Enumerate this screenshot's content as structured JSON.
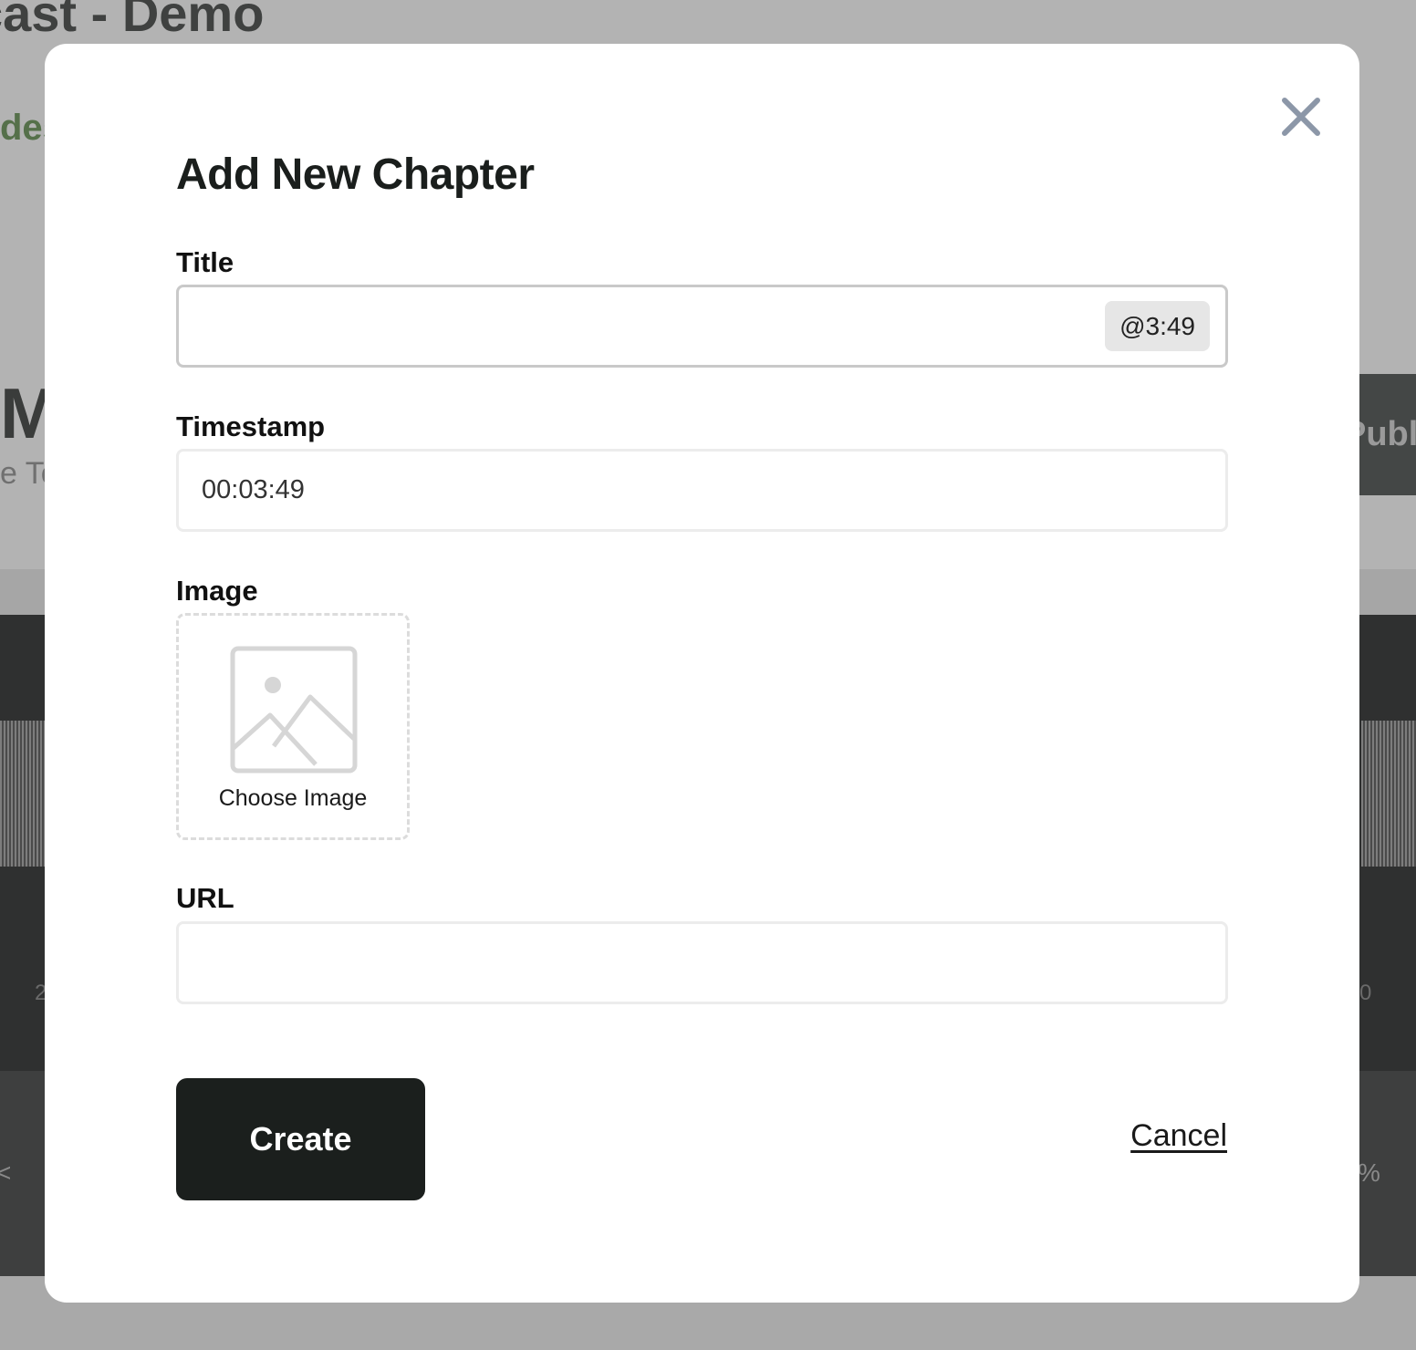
{
  "background": {
    "page_title": "cast - Demo",
    "nav_link": "des",
    "episode_initial": "M",
    "episode_sub": "e To",
    "publish_label": "Publ",
    "tick_left": "2",
    "tick_right": "0",
    "ctrl_left": "<",
    "ctrl_right": "%"
  },
  "modal": {
    "title": "Add New Chapter",
    "close_icon": "close-icon",
    "fields": {
      "title": {
        "label": "Title",
        "value": "",
        "timestamp_pill": "@3:49"
      },
      "timestamp": {
        "label": "Timestamp",
        "value": "00:03:49"
      },
      "image": {
        "label": "Image",
        "icon": "image-placeholder-icon",
        "caption": "Choose Image"
      },
      "url": {
        "label": "URL",
        "value": ""
      }
    },
    "actions": {
      "create_label": "Create",
      "cancel_label": "Cancel"
    }
  },
  "colors": {
    "overlay": "#b3b3b3",
    "primary_button": "#1b1f1d",
    "close_icon": "#8c97a8",
    "field_border": "#ececec"
  }
}
